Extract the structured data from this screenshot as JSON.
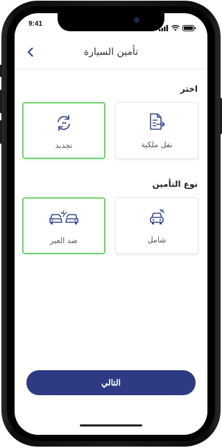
{
  "status_bar": {
    "time": "9:41"
  },
  "header": {
    "title": "تأمين السيارة",
    "back_icon": "chevron-left-icon"
  },
  "sections": [
    {
      "label": "اختر",
      "options": [
        {
          "label": "نقل ملكية",
          "icon": "document-transfer-icon",
          "selected": false
        },
        {
          "label": "تجديد",
          "icon": "renew-arrows-icon",
          "selected": true
        }
      ]
    },
    {
      "label": "نوع التأمين",
      "options": [
        {
          "label": "شامل",
          "icon": "car-crash-single-icon",
          "selected": false
        },
        {
          "label": "ضد الغير",
          "icon": "car-collision-icon",
          "selected": true
        }
      ]
    }
  ],
  "footer": {
    "next_label": "التالي"
  },
  "colors": {
    "accent": "#2e3a82",
    "selected_border": "#6dd36d",
    "icon": "#3a4a8a"
  }
}
